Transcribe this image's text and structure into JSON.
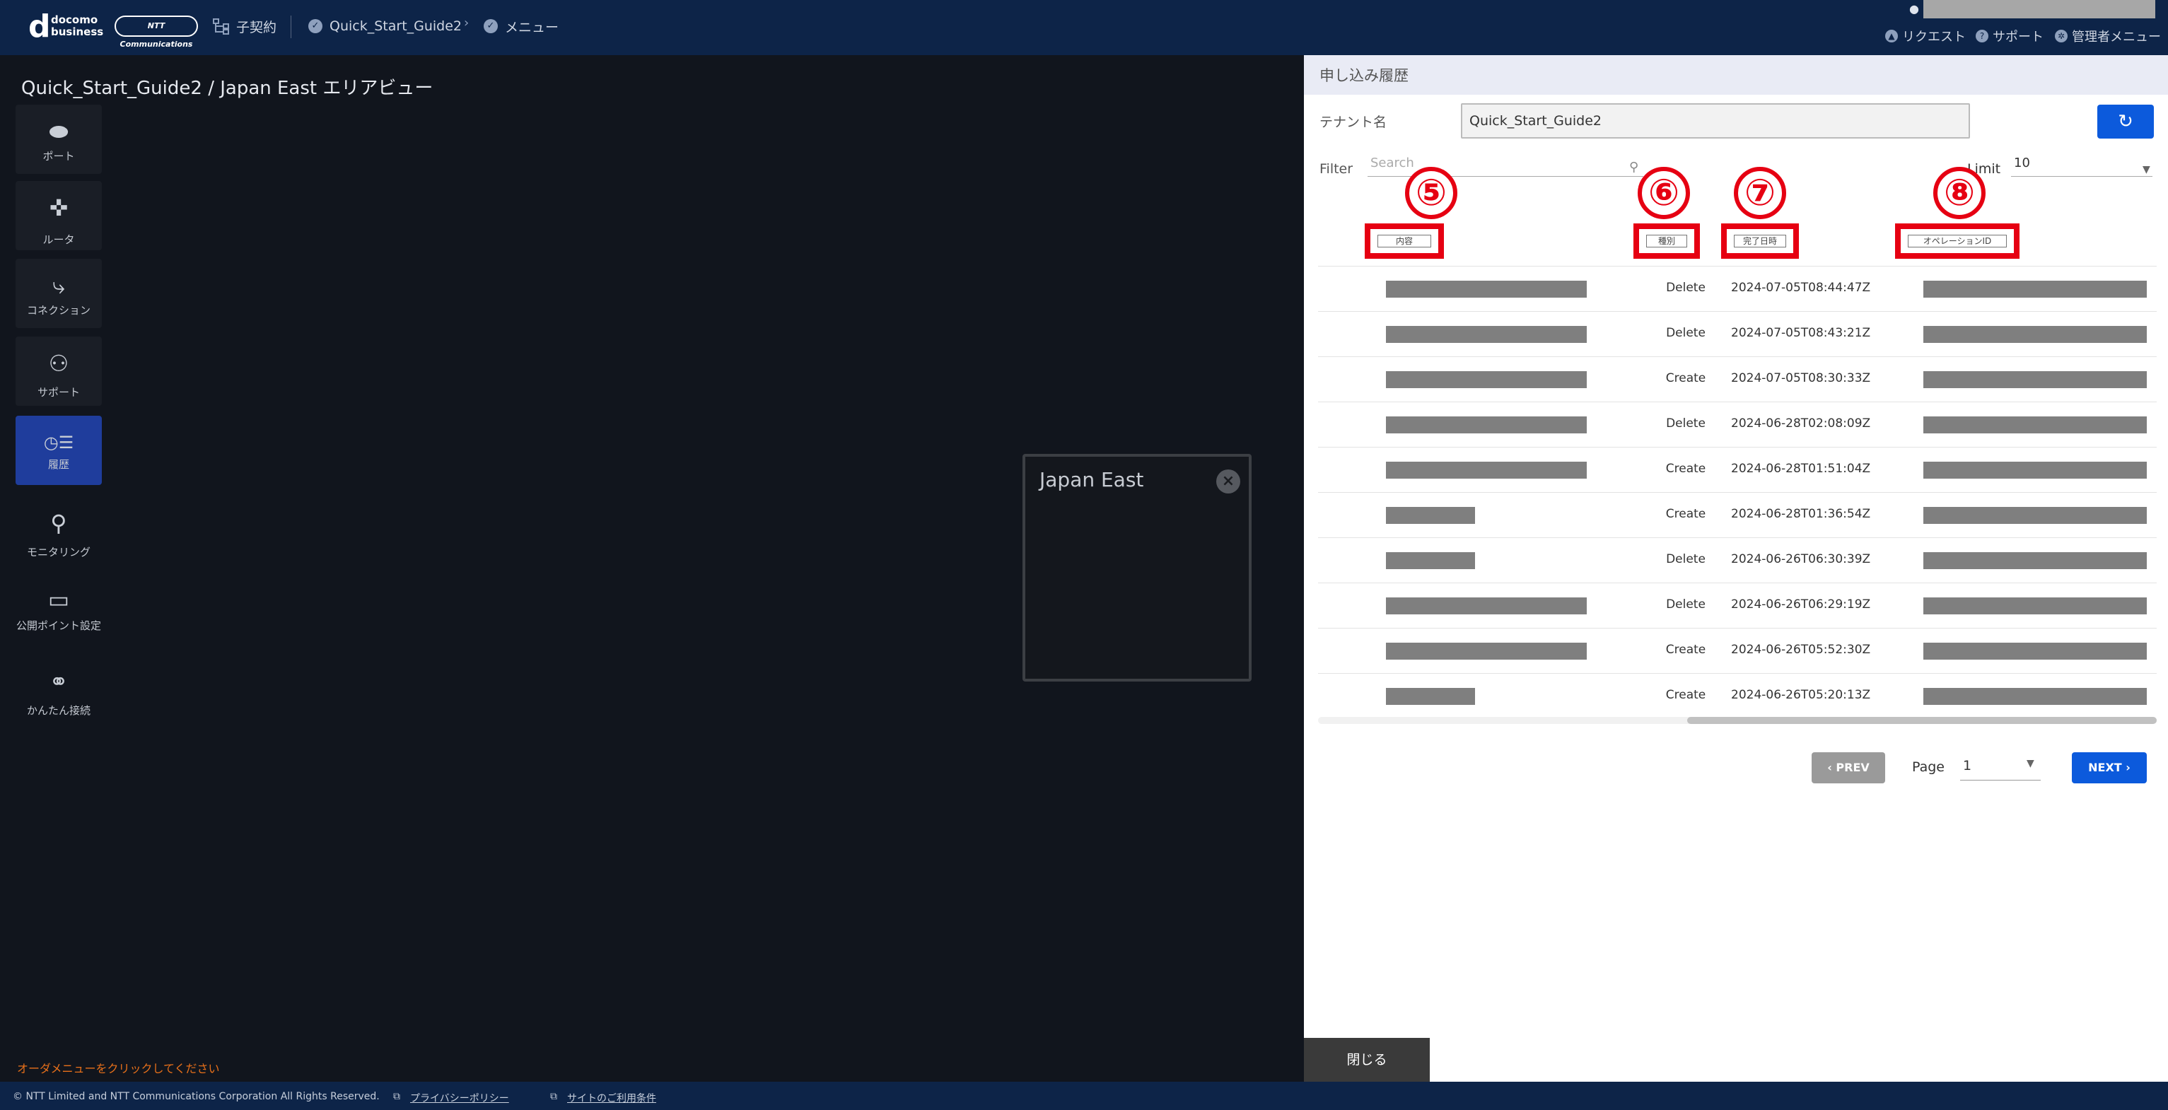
{
  "header": {
    "logo_mark": "d",
    "logo_text_1": "docomo",
    "logo_text_2": "business",
    "ntt_logo": "NTT Communications",
    "contract": "子契約",
    "tenant": "Quick_Start_Guide2",
    "menu": "メニュー",
    "request": "リクエスト",
    "support": "サポート",
    "admin_menu": "管理者メニュー"
  },
  "map": {
    "title": "Quick_Start_Guide2 / Japan East エリアビュー",
    "region_name": "Japan East",
    "order_hint": "オーダメニューをクリックしてください"
  },
  "sidebar": {
    "items": [
      {
        "label": "ポート",
        "icon": "port-icon"
      },
      {
        "label": "ルータ",
        "icon": "router-icon"
      },
      {
        "label": "コネクション",
        "icon": "connection-icon"
      },
      {
        "label": "サポート",
        "icon": "support-user-icon"
      },
      {
        "label": "履歴",
        "icon": "history-icon"
      },
      {
        "label": "モニタリング",
        "icon": "monitoring-icon"
      },
      {
        "label": "公開ポイント設定",
        "icon": "public-point-icon"
      },
      {
        "label": "かんたん接続",
        "icon": "easy-connect-icon"
      }
    ]
  },
  "panel": {
    "title": "申し込み履歴",
    "tenant_label": "テナント名",
    "tenant_value": "Quick_Start_Guide2",
    "filter_label": "Filter",
    "search_placeholder": "Search",
    "limit_label": "Limit",
    "limit_value": "10",
    "columns": [
      "内容",
      "種別",
      "完了日時",
      "オペレーションID"
    ],
    "callouts": [
      "⑤",
      "⑥",
      "⑦",
      "⑧"
    ],
    "rows": [
      {
        "type": "Delete",
        "completed": "2024-07-05T08:44:47Z",
        "content_redacted": "long"
      },
      {
        "type": "Delete",
        "completed": "2024-07-05T08:43:21Z",
        "content_redacted": "long"
      },
      {
        "type": "Create",
        "completed": "2024-07-05T08:30:33Z",
        "content_redacted": "long"
      },
      {
        "type": "Delete",
        "completed": "2024-06-28T02:08:09Z",
        "content_redacted": "long"
      },
      {
        "type": "Create",
        "completed": "2024-06-28T01:51:04Z",
        "content_redacted": "long"
      },
      {
        "type": "Create",
        "completed": "2024-06-28T01:36:54Z",
        "content_redacted": "short"
      },
      {
        "type": "Delete",
        "completed": "2024-06-26T06:30:39Z",
        "content_redacted": "short"
      },
      {
        "type": "Delete",
        "completed": "2024-06-26T06:29:19Z",
        "content_redacted": "long"
      },
      {
        "type": "Create",
        "completed": "2024-06-26T05:52:30Z",
        "content_redacted": "long"
      },
      {
        "type": "Create",
        "completed": "2024-06-26T05:20:13Z",
        "content_redacted": "short"
      }
    ],
    "prev_label": "PREV",
    "page_label": "Page",
    "page_value": "1",
    "next_label": "NEXT",
    "close_label": "閉じる"
  },
  "footer": {
    "copyright": "© NTT Limited and NTT Communications Corporation All Rights Reserved.",
    "privacy": "プライバシーポリシー",
    "terms": "サイトのご利用条件"
  },
  "colors": {
    "topbar": "#0d2448",
    "accent": "#0c5adc",
    "callout": "#e60012",
    "active_nav": "#1f3d9c",
    "hint": "#e8701a"
  }
}
